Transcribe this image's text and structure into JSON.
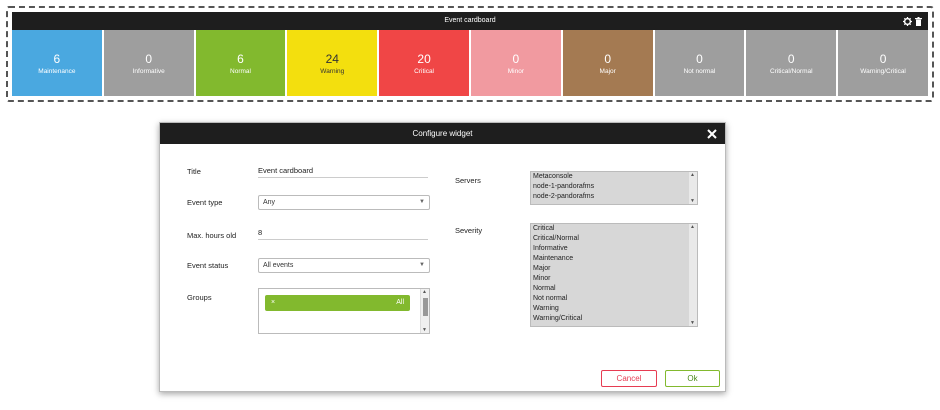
{
  "cardboard": {
    "title": "Event cardboard",
    "tiles": [
      {
        "count": "6",
        "label": "Maintenance",
        "color": "#4aa8e0"
      },
      {
        "count": "0",
        "label": "Informative",
        "color": "#9e9e9e"
      },
      {
        "count": "6",
        "label": "Normal",
        "color": "#82b92e"
      },
      {
        "count": "24",
        "label": "Warning",
        "color": "#f3df0e"
      },
      {
        "count": "20",
        "label": "Critical",
        "color": "#f04646"
      },
      {
        "count": "0",
        "label": "Minor",
        "color": "#f19aa0"
      },
      {
        "count": "0",
        "label": "Major",
        "color": "#a47a52"
      },
      {
        "count": "0",
        "label": "Not normal",
        "color": "#9e9e9e"
      },
      {
        "count": "0",
        "label": "Critical/Normal",
        "color": "#9e9e9e"
      },
      {
        "count": "0",
        "label": "Warning/Critical",
        "color": "#9e9e9e"
      }
    ]
  },
  "dialog": {
    "title": "Configure widget",
    "fields": {
      "title_label": "Title",
      "title_value": "Event cardboard",
      "event_type_label": "Event type",
      "event_type_value": "Any",
      "max_hours_label": "Max. hours old",
      "max_hours_value": "8",
      "event_status_label": "Event status",
      "event_status_value": "All events",
      "groups_label": "Groups",
      "groups_selected": "All",
      "servers_label": "Servers",
      "servers": [
        "Metaconsole",
        "node-1-pandorafms",
        "node-2-pandorafms"
      ],
      "severity_label": "Severity",
      "severity": [
        "Critical",
        "Critical/Normal",
        "Informative",
        "Maintenance",
        "Major",
        "Minor",
        "Normal",
        "Not normal",
        "Warning",
        "Warning/Critical"
      ]
    },
    "buttons": {
      "cancel": "Cancel",
      "ok": "Ok"
    }
  },
  "colors": {
    "header_bg": "#1e1e1e",
    "accent_green": "#82b92e",
    "cancel_red": "#e63c52",
    "listbox_bg": "#d7d7d7"
  }
}
